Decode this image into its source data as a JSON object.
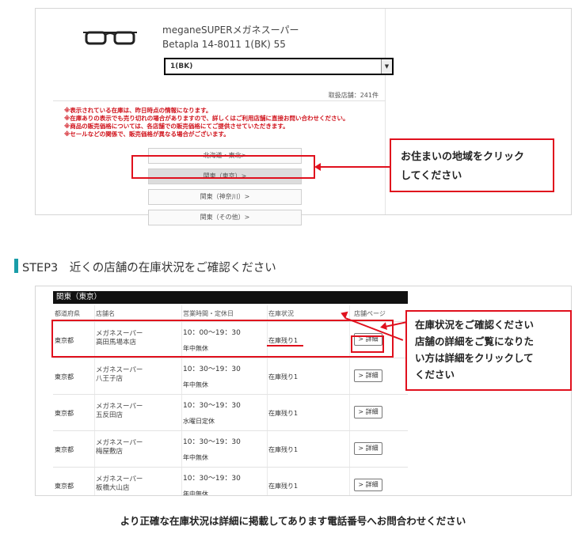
{
  "product": {
    "brand": "meganeSUPERメガネスーパー",
    "model": "Betapla 14-8011 1(BK) 55",
    "color_select": "1(BK)",
    "shop_count": "取扱店舗：241件"
  },
  "notices": [
    "※表示されている在庫は、昨日時点の情報になります。",
    "※在庫ありの表示でも売り切れの場合がありますので、詳しくはご利用店舗に直接お問い合わせください。",
    "※商品の販売価格については、各店舗での販売価格にてご提供させていただきます。",
    "※セールなどの関係で、販売価格が異なる場合がございます。"
  ],
  "regions": [
    "北海道・東北>",
    "関東（東京）>",
    "関東（神奈川）>",
    "関東（その他）>"
  ],
  "callout1": [
    "お住まいの地域をクリック",
    "してください"
  ],
  "step": {
    "title": "STEP3　近くの店舗の在庫状況をご確認ください"
  },
  "table": {
    "title": "関東（東京）",
    "headers": [
      "都道府県",
      "店舗名",
      "営業時間・定休日",
      "在庫状況",
      "店舗ページ"
    ],
    "rows": [
      {
        "pref": "東京都",
        "brand": "メガネスーパー",
        "shop": "高田馬場本店",
        "hours": "10：00〜19：30",
        "holiday": "年中無休",
        "stock": "在庫残り1",
        "detail": "> 詳細"
      },
      {
        "pref": "東京都",
        "brand": "メガネスーパー",
        "shop": "八王子店",
        "hours": "10：30〜19：30",
        "holiday": "年中無休",
        "stock": "在庫残り1",
        "detail": "> 詳細"
      },
      {
        "pref": "東京都",
        "brand": "メガネスーパー",
        "shop": "五反田店",
        "hours": "10：30〜19：30",
        "holiday": "水曜日定休",
        "stock": "在庫残り1",
        "detail": "> 詳細"
      },
      {
        "pref": "東京都",
        "brand": "メガネスーパー",
        "shop": "梅屋敷店",
        "hours": "10：30〜19：30",
        "holiday": "年中無休",
        "stock": "在庫残り1",
        "detail": "> 詳細"
      },
      {
        "pref": "東京都",
        "brand": "メガネスーパー",
        "shop": "板橋大山店",
        "hours": "10：30〜19：30",
        "holiday": "年中無休",
        "stock": "在庫残り1",
        "detail": "> 詳細"
      }
    ]
  },
  "callout2": [
    "在庫状況をご確認ください",
    "店舗の詳細をご覧になりた",
    "い方は詳細をクリックして",
    "ください"
  ],
  "footer": "より正確な在庫状況は詳細に掲載してあります電話番号へお問合わせください",
  "colors": {
    "highlight": "#e0101d",
    "accent": "#1a9da8",
    "notice": "#d0121b"
  }
}
